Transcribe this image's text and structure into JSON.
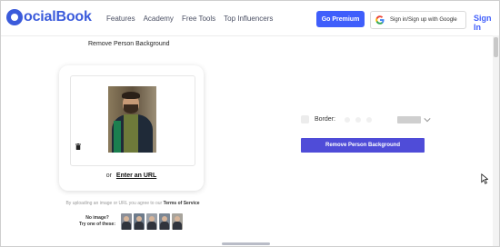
{
  "brand": {
    "logo_text": "ocialBook",
    "accent": "#3f5efb"
  },
  "nav": {
    "items": [
      "Features",
      "Academy",
      "Free Tools",
      "Top Influencers"
    ]
  },
  "header": {
    "premium_label": "Go Premium",
    "google_label": "Sign in/Sign up with Google",
    "signin_label": "Sign In"
  },
  "tool": {
    "title": "Remove Person Background",
    "url_prefix": "or",
    "url_link": "Enter an URL",
    "terms_text": "By uploading an image or URL you agree to our",
    "terms_link": "Terms of Service",
    "noimage_line1": "No image?",
    "noimage_line2": "Try one of these:",
    "sample_count_label": ""
  },
  "options": {
    "border_label": "Border:",
    "remove_button": "Remove Person Background",
    "button_color": "#4f4cd8"
  },
  "icons": [
    "google-icon",
    "trash-icon",
    "chevron-down-icon",
    "mouse-cursor-icon"
  ]
}
